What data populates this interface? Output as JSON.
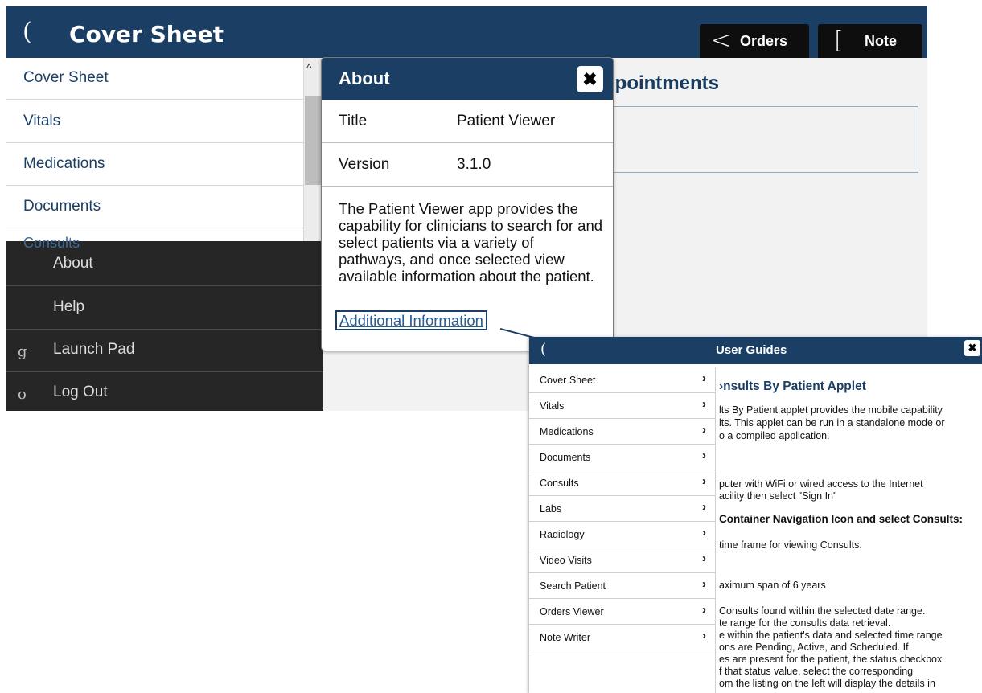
{
  "app": {
    "menu_icon": "(",
    "title": "Cover Sheet",
    "header_buttons": [
      {
        "glyph": "<",
        "label": "Orders"
      },
      {
        "glyph": "[",
        "label": "Note"
      }
    ]
  },
  "sidebar": {
    "items": [
      {
        "label": "Cover Sheet"
      },
      {
        "label": "Vitals"
      },
      {
        "label": "Medications"
      },
      {
        "label": "Documents"
      }
    ],
    "partial_item": "Consults",
    "scroll_up_glyph": "^"
  },
  "main": {
    "section_title": "ppointments"
  },
  "menu": {
    "items": [
      {
        "icon": "",
        "label": "About"
      },
      {
        "icon": "",
        "label": "Help"
      },
      {
        "icon": "g",
        "label": "Launch Pad"
      },
      {
        "icon": "o",
        "label": "Log Out"
      }
    ]
  },
  "about": {
    "title": "About",
    "close_glyph": "✖",
    "rows": [
      {
        "key": "Title",
        "value": "Patient Viewer"
      },
      {
        "key": "Version",
        "value": "3.1.0"
      }
    ],
    "description": "The Patient Viewer app provides the capability for clinicians to search for and select patients via a variety of pathways, and once selected view available information about the patient.",
    "link_label": "Additional Information"
  },
  "guides": {
    "menu_icon": "(",
    "title": "User Guides",
    "close_glyph": "✖",
    "chevron": "›",
    "nav": [
      "Cover Sheet",
      "Vitals",
      "Medications",
      "Documents",
      "Consults",
      "Labs",
      "Radiology",
      "Video Visits",
      "Search Patient",
      "Orders Viewer",
      "Note Writer"
    ],
    "heading": "›nsults By Patient Applet",
    "lines": [
      "lts By Patient applet provides the mobile capability",
      "lts. This applet can be run in a standalone mode or",
      "o a compiled application.",
      "puter with WiFi or wired access to the Internet",
      "acility then select \"Sign In\"",
      "Container Navigation Icon and select Consults:",
      "time frame for viewing Consults.",
      "aximum span of 6 years",
      "Consults found within the selected date range.",
      "te range for the consults data retrieval.",
      "e within the patient's data and selected time range",
      "ons are Pending, Active, and Scheduled. If",
      "es are present for the patient, the status checkbox",
      "f that status value, select the corresponding",
      "om the listing on the left will display the details in"
    ]
  },
  "colors": {
    "header_bg": "#1b3f64",
    "menu_bg": "#262626",
    "link": "#2a5c94"
  }
}
